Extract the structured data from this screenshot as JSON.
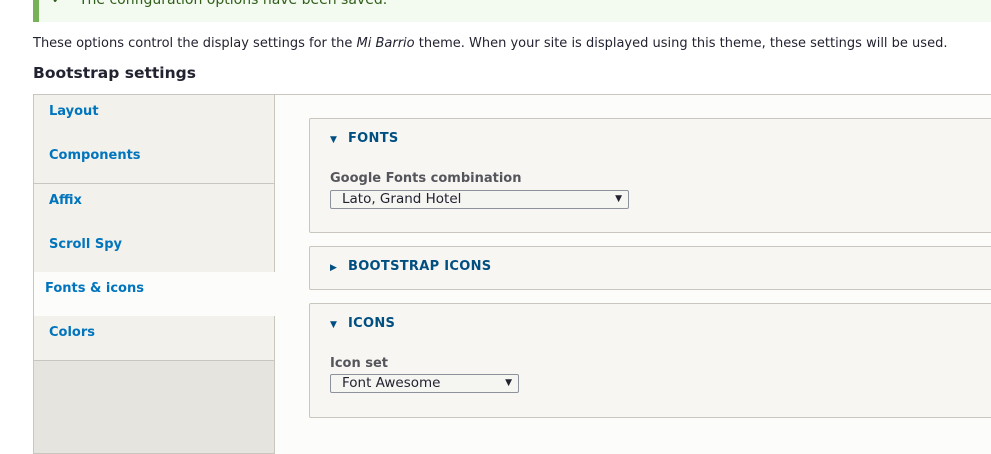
{
  "status": {
    "message": "The configuration options have been saved.",
    "icon": "check-icon"
  },
  "description": {
    "before": "These options control the display settings for the ",
    "theme": "Mi Barrio",
    "after": " theme. When your site is displayed using this theme, these settings will be used."
  },
  "heading": "Bootstrap settings",
  "tabs": [
    {
      "label": "Layout"
    },
    {
      "label": "Components"
    },
    {
      "label": "Affix"
    },
    {
      "label": "Scroll Spy"
    },
    {
      "label": "Fonts & icons",
      "selected": true
    },
    {
      "label": "Colors"
    }
  ],
  "panels": {
    "fonts": {
      "title": "FONTS",
      "field_label": "Google Fonts combination",
      "value": "Lato, Grand Hotel"
    },
    "bootstrap_icons": {
      "title": "BOOTSTRAP ICONS"
    },
    "icons": {
      "title": "ICONS",
      "field_label": "Icon set",
      "value": "Font Awesome"
    }
  },
  "colors": {
    "link": "#0074bd",
    "summary": "#004f80",
    "status_border": "#77b259",
    "status_bg": "#f3faef"
  }
}
